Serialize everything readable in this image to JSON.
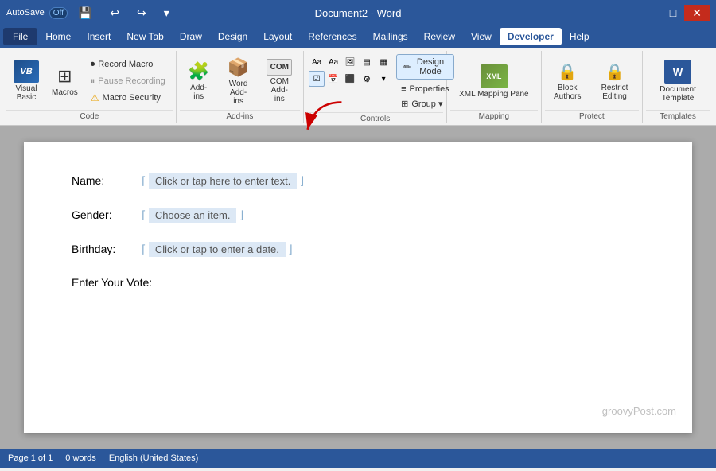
{
  "titleBar": {
    "autosave": "AutoSave",
    "offLabel": "Off",
    "docTitle": "Document2 - Word",
    "undoIcon": "↩",
    "redoIcon": "↪",
    "saveIcon": "💾",
    "minIcon": "—",
    "maxIcon": "□",
    "closeIcon": "✕"
  },
  "menuBar": {
    "items": [
      "File",
      "Home",
      "Insert",
      "New Tab",
      "Draw",
      "Design",
      "Layout",
      "References",
      "Mailings",
      "Review",
      "View",
      "Developer",
      "Help"
    ]
  },
  "ribbon": {
    "activeTab": "Developer",
    "groups": {
      "code": {
        "label": "Code",
        "visualBasic": "Visual\nBasic",
        "macros": "Macros",
        "recordMacro": "Record Macro",
        "pauseRecording": "Pause Recording",
        "macroSecurity": "Macro Security"
      },
      "addIns": {
        "label": "Add-ins",
        "addIns": "Add-\nins",
        "wordAddIns": "Word\nAdd-ins",
        "comAddIns": "COM\nAdd-ins"
      },
      "controls": {
        "label": "Controls",
        "designMode": "Design Mode",
        "properties": "Properties",
        "group": "Group ▾"
      },
      "mapping": {
        "label": "Mapping",
        "xmlMappingPane": "XML Mapping\nPane"
      },
      "protect": {
        "label": "Protect",
        "blockAuthors": "Block\nAuthors",
        "restrictEditing": "Restrict\nEditing"
      },
      "templates": {
        "label": "Templates",
        "documentTemplate": "Document\nTemplate"
      }
    }
  },
  "document": {
    "formFields": [
      {
        "label": "Name:",
        "value": "Click or tap here to enter text.",
        "type": "text"
      },
      {
        "label": "Gender:",
        "value": "Choose an item.",
        "type": "dropdown"
      },
      {
        "label": "Birthday:",
        "value": "Click or tap to enter a date.",
        "type": "date"
      }
    ],
    "voteLabel": "Enter Your Vote:",
    "watermark": "groovyPost.com"
  },
  "statusBar": {
    "page": "Page 1 of 1",
    "words": "0 words",
    "language": "English (United States)"
  }
}
